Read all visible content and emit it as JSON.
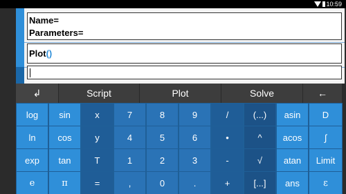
{
  "status_bar": {
    "time": "10:59"
  },
  "editor": {
    "line_name": "Name=",
    "line_parameters": "Parameters=",
    "line_plot_prefix": "Plot",
    "line_plot_parens": "()",
    "input_value": ""
  },
  "toolbar": {
    "enter_label": "↲",
    "script_label": "Script",
    "plot_label": "Plot",
    "solve_label": "Solve",
    "backspace_label": "←"
  },
  "keypad": {
    "rows": [
      [
        "log",
        "sin",
        "x",
        "7",
        "8",
        "9",
        "/",
        "(...)",
        "asin",
        "D"
      ],
      [
        "ln",
        "cos",
        "y",
        "4",
        "5",
        "6",
        "•",
        "^",
        "acos",
        "∫"
      ],
      [
        "exp",
        "tan",
        "T",
        "1",
        "2",
        "3",
        "-",
        "√",
        "atan",
        "Limit"
      ],
      [
        "e",
        "π",
        "=",
        ",",
        "0",
        ".",
        "+",
        "[...]",
        "ans",
        "ε"
      ]
    ]
  },
  "colors": {
    "accent": "#2f8fd9",
    "key_light": "#2f8fd9",
    "key_mid": "#2a73b6",
    "key_dark": "#1f5d97",
    "background": "#2b2b2b"
  }
}
